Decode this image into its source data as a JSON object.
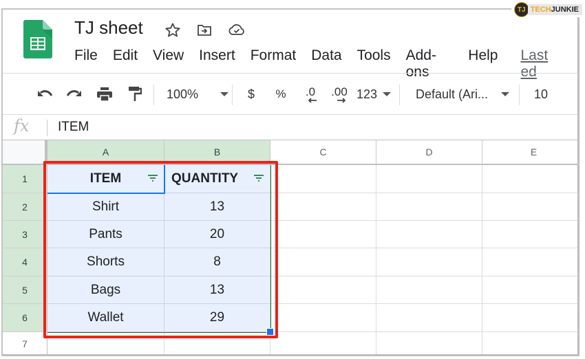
{
  "watermark": {
    "tech": "TECH",
    "junkie": "JUNKIE",
    "logo": "TJ"
  },
  "document": {
    "title": "TJ sheet"
  },
  "header_icons": [
    "star-icon",
    "move-to-folder-icon",
    "cloud-saved-icon"
  ],
  "menu": {
    "items": [
      "File",
      "Edit",
      "View",
      "Insert",
      "Format",
      "Data",
      "Tools",
      "Add-ons",
      "Help"
    ],
    "last_edit": "Last ed"
  },
  "toolbar": {
    "zoom": "100%",
    "currency": "$",
    "percent": "%",
    "decrease_decimal": ".0",
    "increase_decimal": ".00",
    "more_formats": "123",
    "font": "Default (Ari...",
    "font_size": "10"
  },
  "formula_bar": {
    "fx": "fx",
    "value": "ITEM"
  },
  "sheet": {
    "columns": [
      "A",
      "B",
      "C",
      "D",
      "E"
    ],
    "rows": [
      "1",
      "2",
      "3",
      "4",
      "5",
      "6",
      "7"
    ],
    "headers": [
      "ITEM",
      "QUANTITY"
    ],
    "data": [
      [
        "Shirt",
        "13"
      ],
      [
        "Pants",
        "20"
      ],
      [
        "Shorts",
        "8"
      ],
      [
        "Bags",
        "13"
      ],
      [
        "Wallet",
        "29"
      ]
    ],
    "selected_range": "A1:B6",
    "active_cell": "A1"
  },
  "colors": {
    "highlight": "#e8231c",
    "selection_fill": "#e8f0fe",
    "header_selected": "#d3e8d5",
    "accent": "#1a73e8",
    "sheets_green": "#0f9d58"
  }
}
